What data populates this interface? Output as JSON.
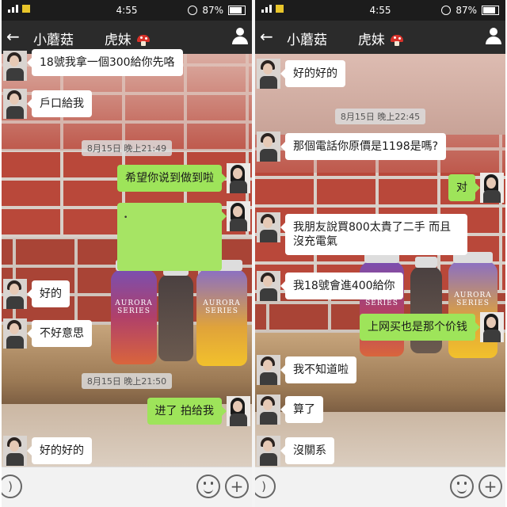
{
  "status_bar": {
    "time": "4:55",
    "battery": "87%"
  },
  "left": {
    "header_title": "小蘑菇",
    "header_name": "虎妹",
    "messages": [
      {
        "from": "them",
        "text": "18號我拿一個300給你先咯"
      },
      {
        "from": "them",
        "text": "戶口給我"
      },
      {
        "type": "timestamp",
        "text": "8月15日 晚上21:49"
      },
      {
        "from": "me",
        "text": "希望你说到做到啦"
      },
      {
        "from": "them",
        "text": "好的"
      },
      {
        "from": "them",
        "text": "不好意思"
      },
      {
        "type": "timestamp",
        "text": "8月15日 晚上21:50"
      },
      {
        "from": "me",
        "text": "进了 拍给我"
      },
      {
        "from": "them",
        "text": "好的好的"
      }
    ]
  },
  "right": {
    "header_title": "小蘑菇",
    "header_name": "虎妹",
    "messages": [
      {
        "from": "them",
        "text": "好的好的"
      },
      {
        "type": "timestamp",
        "text": "8月15日 晚上22:45"
      },
      {
        "from": "them",
        "text": "那個電話你原價是1198是嗎?"
      },
      {
        "from": "me",
        "text": "对"
      },
      {
        "from": "them",
        "text": "我朋友說買800太貴了二手 而且沒充電氣"
      },
      {
        "from": "them",
        "text": "我18號會進400給你"
      },
      {
        "from": "me",
        "text": "上网买也是那个价钱"
      },
      {
        "from": "them",
        "text": "我不知道啦"
      },
      {
        "from": "them",
        "text": "算了"
      },
      {
        "from": "them",
        "text": "沒關系"
      }
    ]
  },
  "jar_label": "AURORA SERIES",
  "icons": [
    "back-arrow-icon",
    "person-icon",
    "voice-icon",
    "emoji-icon",
    "plus-icon",
    "mushroom-icon"
  ]
}
